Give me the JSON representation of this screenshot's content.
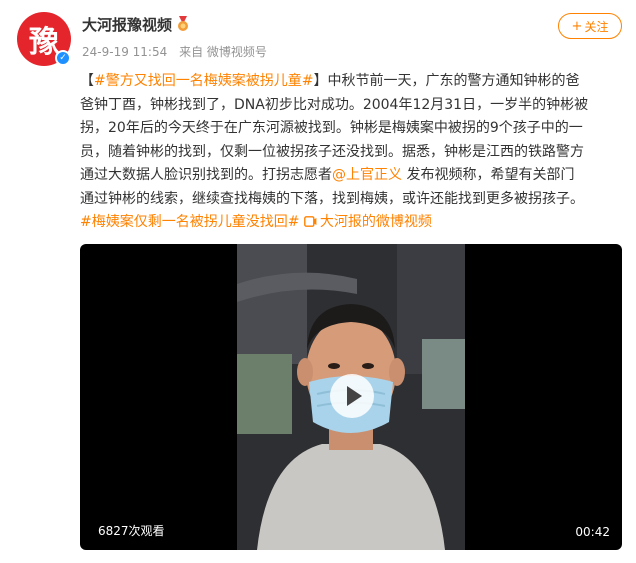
{
  "author": {
    "avatar_char": "豫",
    "name": "大河报豫视频",
    "badge_icon": "medal-icon",
    "verified_icon": "verified-check-icon"
  },
  "meta": {
    "timestamp": "24-9-19 11:54",
    "source": "来自 微博视频号"
  },
  "follow_button": {
    "plus": "+",
    "label": "关注"
  },
  "content": {
    "line1_prefix": "【",
    "headline_tag": "#警方又找回一名梅姨案被拐儿童#",
    "line1_suffix": "】中秋节前一天，广东的警方通知钟彬的爸",
    "line2": "爸钟丁酉，钟彬找到了，DNA初步比对成功。2004年12月31日，一岁半的钟彬被",
    "line3": "拐，20年后的今天终于在广东河源被找到。钟彬是梅姨案中被拐的9个孩子中的一",
    "line4": "员，随着钟彬的找到，仅剩一位被拐孩子还没找到。据悉，钟彬是江西的铁路警方",
    "line5_prefix": "通过大数据人脸识别找到的。打拐志愿者",
    "mention": "@上官正义",
    "line5_suffix": " 发布视频称，希望有关部门",
    "line6": "通过钟彬的线索，继续查找梅姨的下落，找到梅姨，或许还能找到更多被拐孩子。",
    "hashtag2": "#梅姨案仅剩一名被拐儿童没找回#",
    "video_link_icon": "video-link-icon",
    "video_link_label": "大河报的微博视频"
  },
  "video": {
    "views": "6827次观看",
    "duration": "00:42",
    "play_icon": "play-icon"
  },
  "colors": {
    "accent": "#ff8200",
    "mention": "#eb7350",
    "avatar_bg": "#e4262c",
    "verified": "#1e90ff"
  }
}
